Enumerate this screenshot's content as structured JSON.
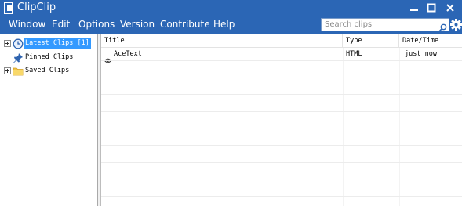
{
  "app": {
    "title": "ClipClip"
  },
  "window_controls": {
    "minimize": "minimize-icon",
    "maximize": "maximize-icon",
    "close": "close-icon"
  },
  "menu": {
    "items": [
      "Window",
      "Edit",
      "Options",
      "Version",
      "Contribute",
      "Help"
    ]
  },
  "search": {
    "placeholder": "Search clips",
    "value": ""
  },
  "tree": {
    "items": [
      {
        "label": "Latest Clips [1]",
        "icon": "clock-icon",
        "selected": true,
        "expandable": true
      },
      {
        "label": "Pinned Clips",
        "icon": "pin-icon",
        "selected": false,
        "expandable": false
      },
      {
        "label": "Saved Clips",
        "icon": "folder-icon",
        "selected": false,
        "expandable": true
      }
    ]
  },
  "grid": {
    "columns": [
      "Title",
      "Type",
      "Date/Time"
    ],
    "rows": [
      {
        "title": "AceText",
        "type": "HTML",
        "datetime": "just now",
        "icon": "eye-icon"
      }
    ]
  },
  "colors": {
    "titlebar": "#2b66b5",
    "selection": "#3399ff"
  }
}
